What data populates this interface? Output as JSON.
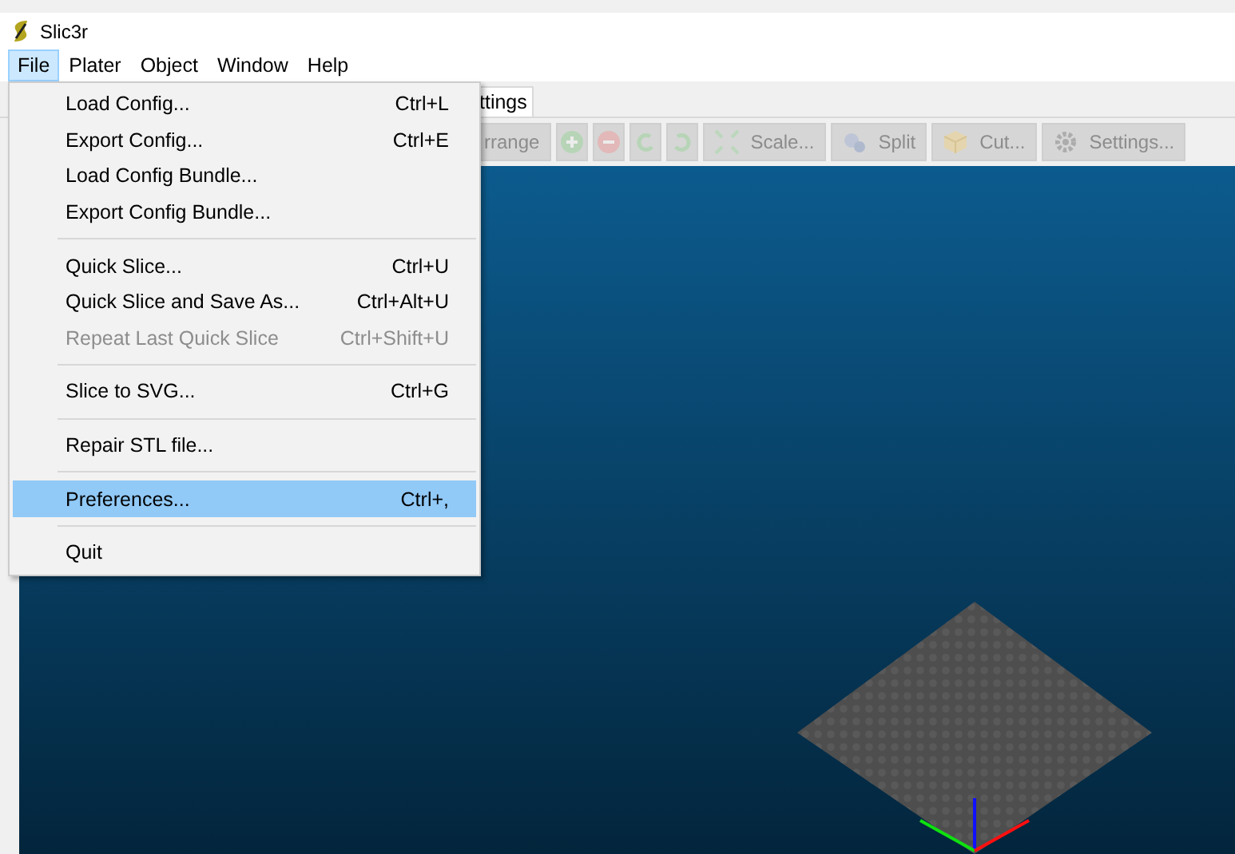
{
  "window": {
    "title": "Slic3r"
  },
  "menu_bar": [
    {
      "label": "File",
      "selected": true
    },
    {
      "label": "Plater",
      "selected": false
    },
    {
      "label": "Object",
      "selected": false
    },
    {
      "label": "Window",
      "selected": false
    },
    {
      "label": "Help",
      "selected": false
    }
  ],
  "tabs": [
    {
      "label": "ttings"
    }
  ],
  "toolbar": [
    {
      "kind": "text",
      "label": "rrange",
      "disabled": true
    },
    {
      "kind": "icon",
      "disabled": true
    },
    {
      "kind": "icon",
      "disabled": true
    },
    {
      "kind": "icon",
      "disabled": true
    },
    {
      "kind": "icon",
      "disabled": true
    },
    {
      "kind": "text",
      "label": "Scale...",
      "disabled": true
    },
    {
      "kind": "text",
      "label": "Split",
      "disabled": true
    },
    {
      "kind": "text",
      "label": "Cut...",
      "disabled": true
    },
    {
      "kind": "text",
      "label": "Settings...",
      "disabled": true
    }
  ],
  "file_menu": [
    {
      "kind": "item",
      "label": "Load Config...",
      "shortcut": "Ctrl+L",
      "disabled": false,
      "selected": false
    },
    {
      "kind": "item",
      "label": "Export Config...",
      "shortcut": "Ctrl+E",
      "disabled": false,
      "selected": false
    },
    {
      "kind": "item",
      "label": "Load Config Bundle...",
      "disabled": false,
      "selected": false
    },
    {
      "kind": "item",
      "label": "Export Config Bundle...",
      "disabled": false,
      "selected": false
    },
    {
      "kind": "separator"
    },
    {
      "kind": "item",
      "label": "Quick Slice...",
      "shortcut": "Ctrl+U",
      "disabled": false,
      "selected": false
    },
    {
      "kind": "item",
      "label": "Quick Slice and Save As...",
      "shortcut": "Ctrl+Alt+U",
      "disabled": false,
      "selected": false
    },
    {
      "kind": "item",
      "label": "Repeat Last Quick Slice",
      "shortcut": "Ctrl+Shift+U",
      "disabled": true,
      "selected": false
    },
    {
      "kind": "separator"
    },
    {
      "kind": "item",
      "label": "Slice to SVG...",
      "shortcut": "Ctrl+G",
      "disabled": false,
      "selected": false
    },
    {
      "kind": "separator"
    },
    {
      "kind": "item",
      "label": "Repair STL file...",
      "disabled": false,
      "selected": false
    },
    {
      "kind": "separator"
    },
    {
      "kind": "item",
      "label": "Preferences...",
      "shortcut": "Ctrl+,",
      "disabled": false,
      "selected": true
    },
    {
      "kind": "separator"
    },
    {
      "kind": "item",
      "label": "Quit",
      "disabled": false,
      "selected": false
    }
  ]
}
